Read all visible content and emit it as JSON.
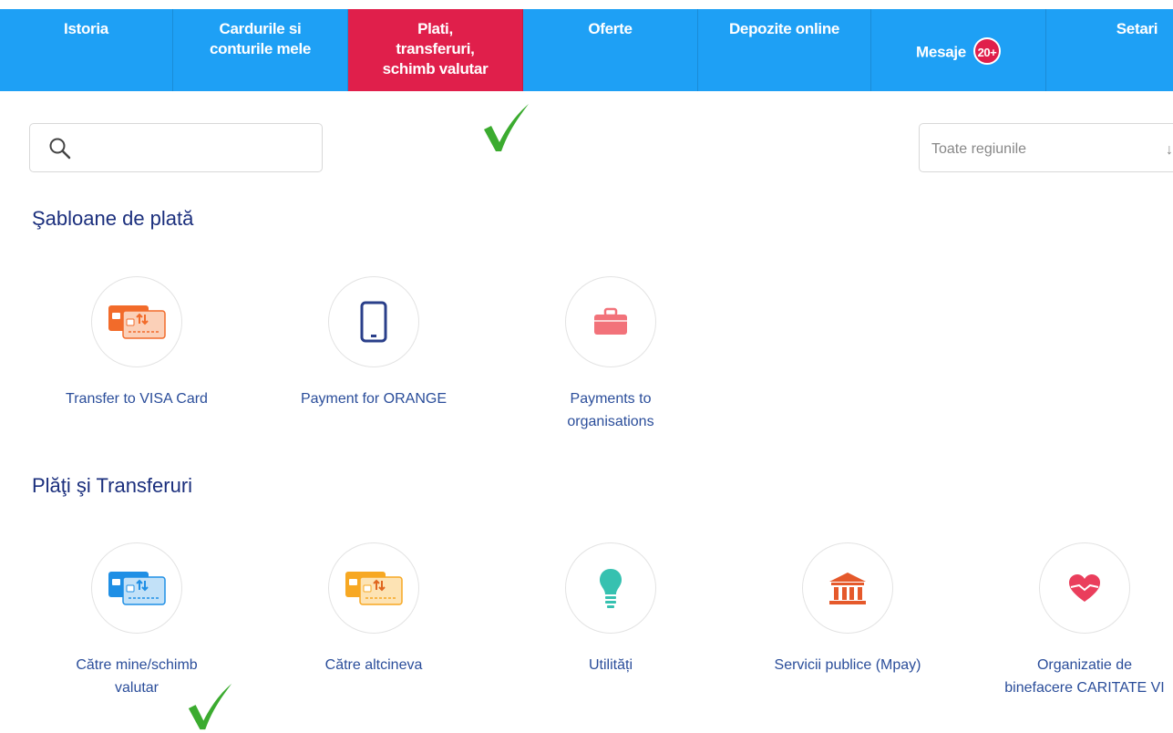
{
  "nav": {
    "items": [
      {
        "label": "Istoria",
        "active": false
      },
      {
        "label": "Cardurile si\nconturile mele",
        "active": false
      },
      {
        "label": "Plati,\ntransferuri,\nschimb valutar",
        "active": true
      },
      {
        "label": "Oferte",
        "active": false
      },
      {
        "label": "Depozite online",
        "active": false
      },
      {
        "label": "Mesaje",
        "badge": "20+",
        "active": false
      },
      {
        "label": "Setari",
        "active": false
      }
    ]
  },
  "search": {
    "value": "",
    "icon": "search-icon"
  },
  "region_select": {
    "value": "Toate regiunile",
    "icon": "arrow-down-icon"
  },
  "templates": {
    "title": "Şabloane de plată",
    "items": [
      {
        "label": "Transfer to VISA Card",
        "icon": "card-transfer-icon"
      },
      {
        "label": "Payment for ORANGE",
        "icon": "mobile-phone-icon"
      },
      {
        "label": "Payments to\norganisations",
        "icon": "briefcase-icon"
      }
    ]
  },
  "transfers": {
    "title": "Plăţi şi Transferuri",
    "items": [
      {
        "label": "Către mine/schimb\nvalutar",
        "icon": "card-transfer-icon"
      },
      {
        "label": "Către altcineva",
        "icon": "card-transfer-icon"
      },
      {
        "label": "Utilități",
        "icon": "light-bulb-icon"
      },
      {
        "label": "Servicii publice (Mpay)",
        "icon": "bank-building-icon"
      },
      {
        "label": "Organizatie de\nbinefacere CARITATE VI",
        "icon": "heart-icon"
      }
    ]
  },
  "colors": {
    "nav_bg": "#1ea0f5",
    "nav_active": "#e01f4b",
    "title": "#1b2f7d",
    "label": "#2a4d9a",
    "check": "#3bab2f"
  }
}
